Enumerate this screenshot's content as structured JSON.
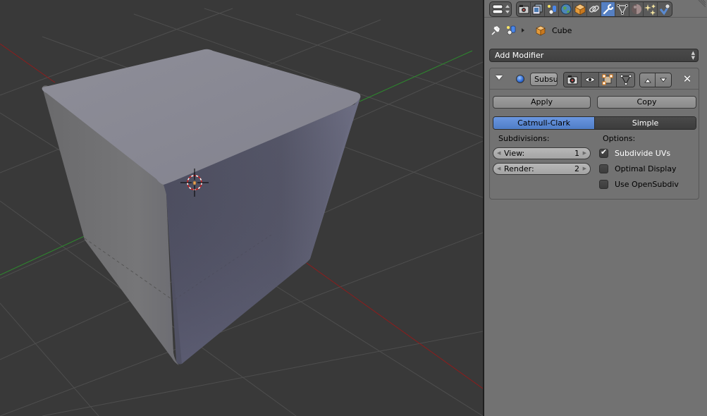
{
  "header": {
    "editor_type_icon": "properties-editor-icon",
    "tabs": [
      {
        "name": "render",
        "icon": "camera-icon",
        "active": false
      },
      {
        "name": "render-layers",
        "icon": "render-layers-icon",
        "active": false
      },
      {
        "name": "scene",
        "icon": "scene-icon",
        "active": false
      },
      {
        "name": "world",
        "icon": "world-icon",
        "active": false
      },
      {
        "name": "object",
        "icon": "object-cube-icon",
        "active": false
      },
      {
        "name": "constraints",
        "icon": "chain-link-icon",
        "active": false
      },
      {
        "name": "modifiers",
        "icon": "wrench-icon",
        "active": true
      },
      {
        "name": "data",
        "icon": "mesh-data-icon",
        "active": false
      },
      {
        "name": "material",
        "icon": "material-sphere-icon",
        "active": false
      },
      {
        "name": "texture",
        "icon": "texture-sparkle-icon",
        "active": false
      },
      {
        "name": "physics",
        "icon": "physics-icon",
        "active": false
      }
    ]
  },
  "context": {
    "object_name": "Cube"
  },
  "add_modifier": {
    "label": "Add Modifier"
  },
  "modifier": {
    "name": "Subsu",
    "apply_label": "Apply",
    "copy_label": "Copy",
    "algorithm": {
      "options": [
        "Catmull-Clark",
        "Simple"
      ],
      "selected": "Catmull-Clark"
    },
    "subdivisions_label": "Subdivisions:",
    "view": {
      "label": "View:",
      "value": "1"
    },
    "render": {
      "label": "Render:",
      "value": "2"
    },
    "options_label": "Options:",
    "options": [
      {
        "label": "Subdivide UVs",
        "checked": true
      },
      {
        "label": "Optimal Display",
        "checked": false
      },
      {
        "label": "Use OpenSubdiv",
        "checked": false
      }
    ]
  },
  "viewport": {
    "object": "Cube",
    "colors": {
      "background": "#393939",
      "grid": "#4e4e4e",
      "x_axis": "#8e1c1c",
      "y_axis": "#2d8a2d",
      "cube_top": "#8a8a96",
      "cube_front": "#5a5b6c",
      "cube_left": "#747478"
    }
  }
}
